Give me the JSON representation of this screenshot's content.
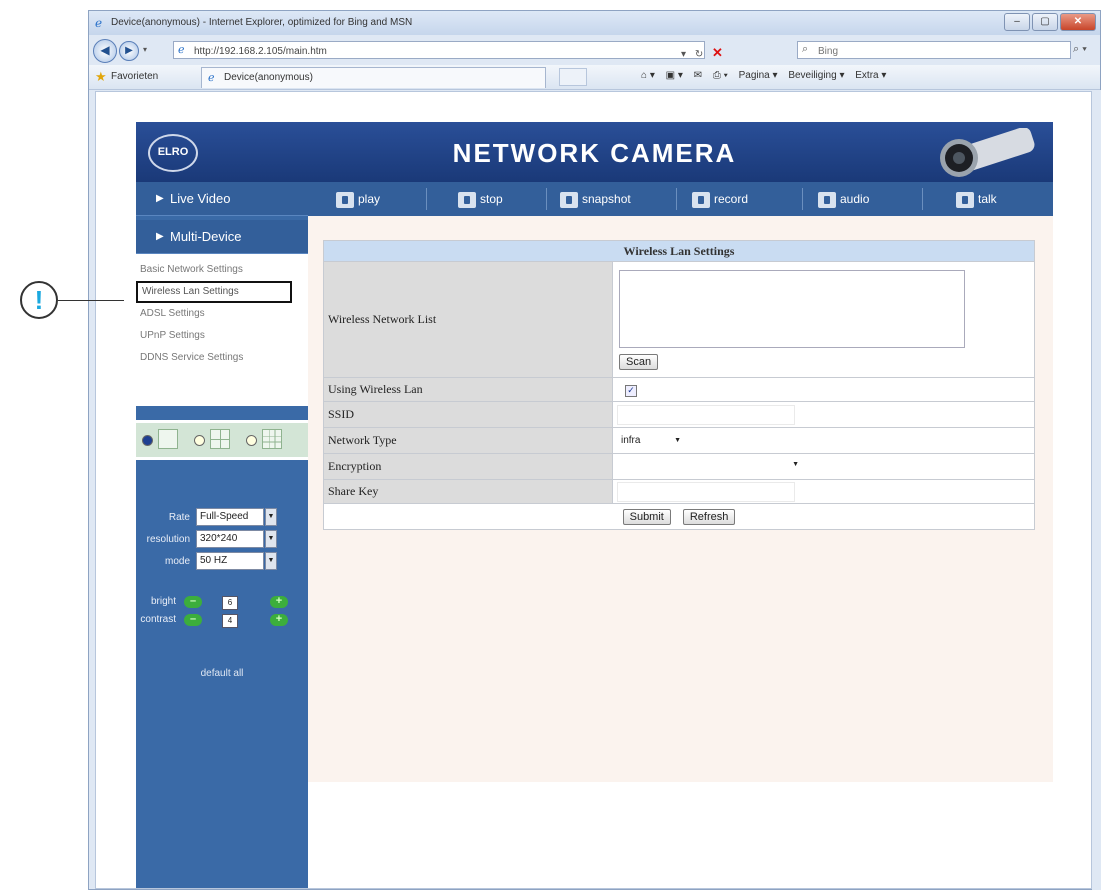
{
  "browser": {
    "window_title": "Device(anonymous) - Internet Explorer, optimized for Bing and MSN",
    "address_url": "http://192.168.2.105/main.htm",
    "search_placeholder": "Bing",
    "favorites_label": "Favorieten",
    "tab_title": "Device(anonymous)",
    "command_bar": [
      "Pagina ▾",
      "Beveiliging ▾",
      "Extra ▾"
    ]
  },
  "camera": {
    "logo_text": "ELRO",
    "header_title": "NETWORK CAMERA",
    "sidebar": {
      "live_video": "Live Video",
      "multi_device": "Multi-Device",
      "menu": [
        "Basic Network Settings",
        "Wireless Lan Settings",
        "ADSL Settings",
        "UPnP Settings",
        "DDNS Service Settings"
      ]
    },
    "controls": {
      "rate_label": "Rate",
      "rate_value": "Full-Speed",
      "resolution_label": "resolution",
      "resolution_value": "320*240",
      "mode_label": "mode",
      "mode_value": "50 HZ",
      "bright_label": "bright",
      "bright_value": "6",
      "contrast_label": "contrast",
      "contrast_value": "4",
      "default_all": "default all"
    },
    "toolbar": [
      "play",
      "stop",
      "snapshot",
      "record",
      "audio",
      "talk"
    ],
    "panel": {
      "title": "Wireless Lan Settings",
      "rows": {
        "network_list": "Wireless Network List",
        "scan": "Scan",
        "using_wlan": "Using Wireless Lan",
        "ssid": "SSID",
        "network_type": "Network Type",
        "network_type_value": "infra",
        "encryption": "Encryption",
        "share_key": "Share Key"
      },
      "submit": "Submit",
      "refresh": "Refresh"
    }
  },
  "callout": {
    "mark": "!"
  },
  "colors": {
    "header_blue": "#2a4f98",
    "sidebar_blue": "#3a6aa7",
    "callout_cyan": "#1aa8df"
  }
}
